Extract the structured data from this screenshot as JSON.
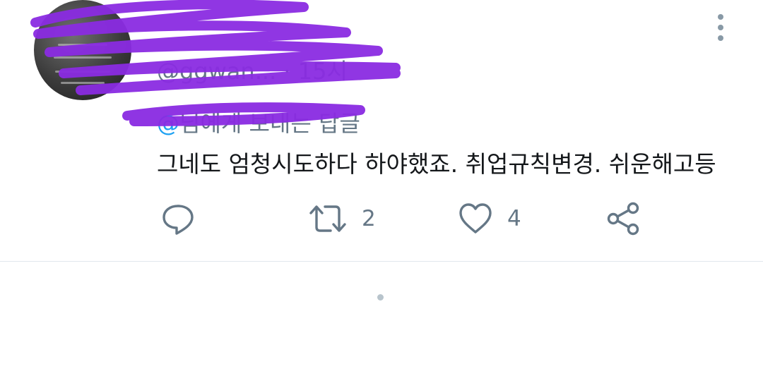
{
  "tweet": {
    "display_name": "",
    "handle_time": "@ggwan... · 15시",
    "reply_mention": "@",
    "reply_suffix": "님에게 보내는 답글",
    "text": "그네도 엄청시도하다 하야했죠. 취업규칙변경. 쉬운해고등",
    "actions": {
      "reply_count": "",
      "retweet_count": "2",
      "like_count": "4"
    }
  },
  "colors": {
    "text": "#14171a",
    "secondary": "#657786",
    "icon": "#657786",
    "link": "#1da1f2",
    "redaction": "#8a2be2",
    "divider": "#e1e8ed"
  },
  "icons": {
    "more": "more-vertical-icon",
    "reply": "comment-bubble-icon",
    "retweet": "retweet-arrows-icon",
    "like": "heart-outline-icon",
    "share": "share-nodes-icon"
  }
}
